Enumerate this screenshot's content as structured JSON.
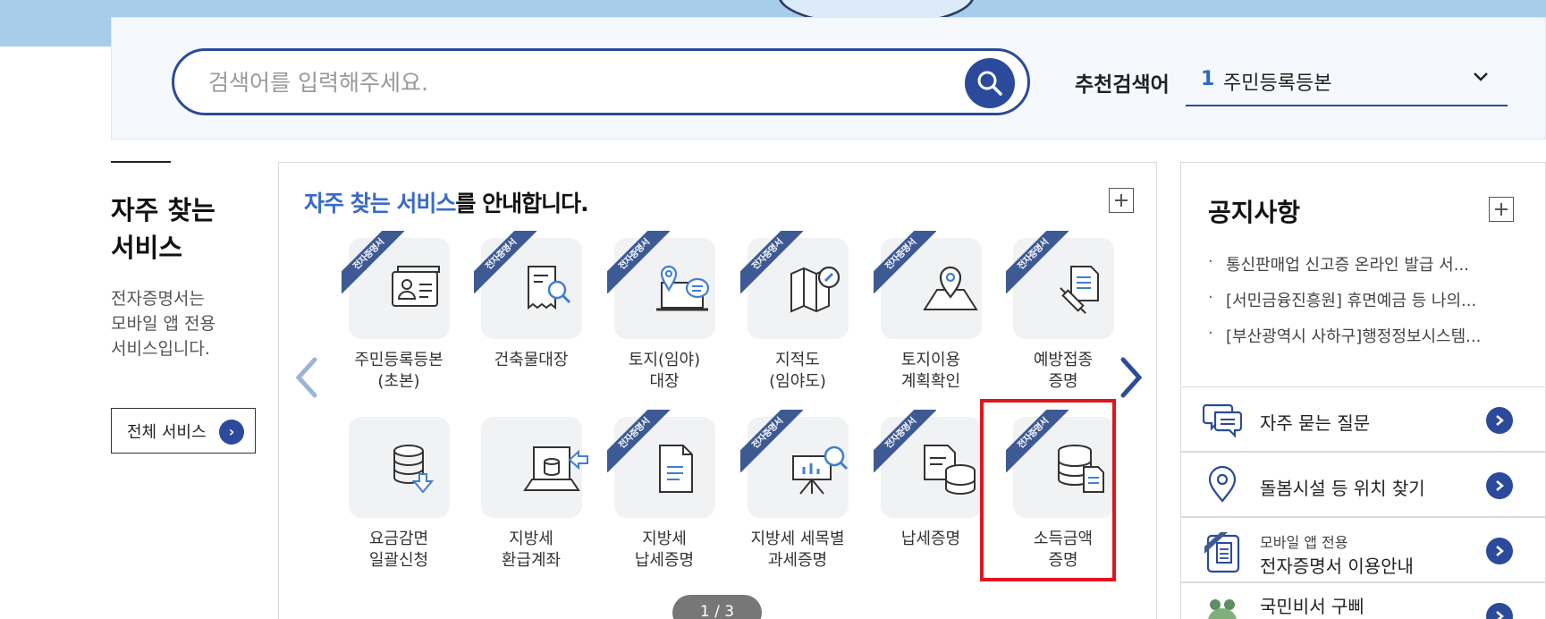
{
  "search": {
    "placeholder": "검색어를 입력해주세요.",
    "recommend_label": "추천검색어",
    "recommend_rank": "1",
    "recommend_text": "주민등록등본"
  },
  "left": {
    "title_line1": "자주 찾는",
    "title_line2": "서비스",
    "desc_line1": "전자증명서는",
    "desc_line2": "모바일 앱 전용",
    "desc_line3": "서비스입니다.",
    "all_button": "전체 서비스"
  },
  "services_panel": {
    "heading_accent": "자주 찾는 서비스",
    "heading_rest": "를 안내합니다.",
    "ribbon_label": "전자증명서",
    "page_indicator": "1 / 3",
    "items": [
      {
        "line1": "주민등록등본",
        "line2": "(초본)",
        "icon": "id-card-icon",
        "badge": true
      },
      {
        "line1": "건축물대장",
        "line2": "",
        "icon": "document-search-icon",
        "badge": true
      },
      {
        "line1": "토지(임야)",
        "line2": "대장",
        "icon": "laptop-location-icon",
        "badge": true
      },
      {
        "line1": "지적도",
        "line2": "(임야도)",
        "icon": "map-search-icon",
        "badge": true
      },
      {
        "line1": "토지이용",
        "line2": "계획확인",
        "icon": "map-pin-icon",
        "badge": true
      },
      {
        "line1": "예방접종",
        "line2": "증명",
        "icon": "syringe-document-icon",
        "badge": true
      },
      {
        "line1": "요금감면",
        "line2": "일괄신청",
        "icon": "database-download-icon",
        "badge": false
      },
      {
        "line1": "지방세",
        "line2": "환급계좌",
        "icon": "database-transfer-icon",
        "badge": false
      },
      {
        "line1": "지방세",
        "line2": "납세증명",
        "icon": "document-icon",
        "badge": true
      },
      {
        "line1": "지방세 세목별",
        "line2": "과세증명",
        "icon": "presentation-chart-icon",
        "badge": true
      },
      {
        "line1": "납세증명",
        "line2": "",
        "icon": "document-database-icon",
        "badge": true
      },
      {
        "line1": "소득금액",
        "line2": "증명",
        "icon": "database-document-icon",
        "badge": true
      }
    ]
  },
  "notice": {
    "title": "공지사항",
    "items": [
      "통신판매업 신고증 온라인 발급 서...",
      "[서민금융진흥원] 휴면예금 등 나의...",
      "[부산광역시 사하구]행정정보시스템..."
    ]
  },
  "quick_links": [
    {
      "text": "자주 묻는 질문",
      "icon": "chat-icon"
    },
    {
      "text": "돌봄시설 등 위치 찾기",
      "icon": "location-pin-icon"
    },
    {
      "sub": "모바일 앱 전용",
      "text": "전자증명서 이용안내",
      "icon": "mobile-certificate-icon"
    },
    {
      "text": "국민비서 구삐",
      "icon": "mascot-icon"
    }
  ],
  "colors": {
    "brand": "#2b4a9b",
    "accent": "#3a6bc8",
    "ribbon": "#3e5a95",
    "highlight": "#e0161d",
    "top_band": "#a8cdea"
  }
}
